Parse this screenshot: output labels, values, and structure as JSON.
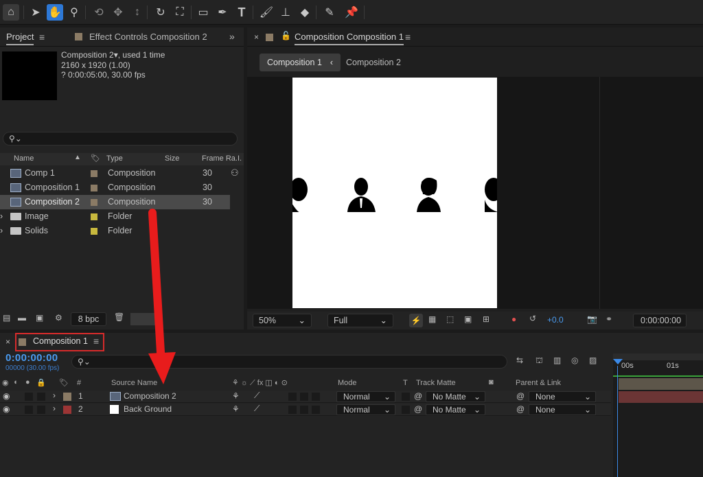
{
  "toolbar": {
    "tools": [
      "home-icon",
      "selection-arrow-icon",
      "hand-icon",
      "zoom-icon",
      "orbit-camera-icon",
      "pan-camera-icon",
      "dolly-camera-icon",
      "rotate-icon",
      "pan-behind-icon",
      "rectangle-icon",
      "pen-icon",
      "type-icon",
      "brush-icon",
      "clone-stamp-icon",
      "eraser-icon",
      "roto-brush-icon",
      "puppet-pin-icon"
    ]
  },
  "project_panel": {
    "tab_project": "Project",
    "tab_effect_controls": "Effect Controls Composition 2",
    "info_name": "Composition 2",
    "info_used": ", used 1 time",
    "info_size": "2160 x 1920 (1.00)",
    "info_duration": "? 0:00:05:00, 30.00 fps",
    "columns": {
      "name": "Name",
      "type": "Type",
      "size": "Size",
      "frame_rate": "Frame Ra...",
      "extra": "I"
    },
    "items": [
      {
        "name": "Comp 1",
        "type": "Composition",
        "frame_rate": "30",
        "icon": "composition-icon",
        "label_color": "#8b7b65"
      },
      {
        "name": "Composition 1",
        "type": "Composition",
        "frame_rate": "30",
        "icon": "composition-icon",
        "label_color": "#8b7b65"
      },
      {
        "name": "Composition 2",
        "type": "Composition",
        "frame_rate": "30",
        "icon": "composition-icon",
        "label_color": "#8b7b65",
        "selected": true
      },
      {
        "name": "Image",
        "type": "Folder",
        "frame_rate": "",
        "icon": "folder-icon",
        "label_color": "#c8b93e"
      },
      {
        "name": "Solids",
        "type": "Folder",
        "frame_rate": "",
        "icon": "folder-icon",
        "label_color": "#c8b93e"
      }
    ],
    "bpc": "8 bpc"
  },
  "viewer": {
    "tab_title": "Composition Composition 1",
    "subtabs": [
      "Composition 1",
      "Composition 2"
    ],
    "zoom": "50%",
    "resolution": "Full",
    "exposure": "+0.0",
    "timecode": "0:00:00:00"
  },
  "timeline": {
    "tab_title": "Composition 1",
    "timecode": "0:00:00:00",
    "fps_note": "00000 (30.00 fps)",
    "columns": {
      "num": "#",
      "source_name": "Source Name",
      "mode": "Mode",
      "t": "T",
      "track_matte": "Track Matte",
      "parent": "Parent & Link"
    },
    "ruler": {
      "start": "00s",
      "mark": "01s"
    },
    "layers": [
      {
        "num": "1",
        "name": "Composition 2",
        "mode": "Normal",
        "matte": "No Matte",
        "parent": "None",
        "label_color": "#8b7b65",
        "bar_color": "#5d564a"
      },
      {
        "num": "2",
        "name": "Back Ground",
        "mode": "Normal",
        "matte": "No Matte",
        "parent": "None",
        "label_color": "#9c3535",
        "bar_color": "#6b3535"
      }
    ]
  },
  "colors": {
    "accent": "#2d78d6",
    "timecode": "#4a9bf0",
    "annotation": "#e81c1c"
  }
}
